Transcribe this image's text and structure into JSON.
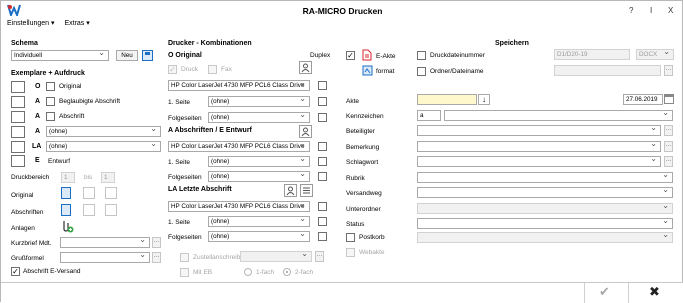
{
  "window": {
    "title": "RA-MICRO Drucken",
    "help": "?",
    "info": "I",
    "close": "X"
  },
  "menu": {
    "settings": "Einstellungen ▾",
    "extras": "Extras ▾"
  },
  "schema": {
    "header": "Schema",
    "value": "Individuell",
    "new_label": "Neu"
  },
  "copies": {
    "header": "Exemplare + Aufdruck",
    "rows": [
      {
        "letter": "O",
        "text": "Original"
      },
      {
        "letter": "A",
        "text": "Beglaubigte Abschrift"
      },
      {
        "letter": "A",
        "text": "Abschrift"
      },
      {
        "letter": "A",
        "text": "(ohne)"
      },
      {
        "letter": "LA",
        "text": "(ohne)"
      },
      {
        "letter": "E",
        "text": "Entwurf"
      }
    ]
  },
  "range": {
    "label": "Druckbereich",
    "from": "1",
    "to_label": "bis",
    "to": "1"
  },
  "layout": {
    "original": "Original",
    "copies": "Abschriften",
    "attachments": "Anlagen"
  },
  "short_letter": {
    "label": "Kurzbrief Mdt."
  },
  "greeting": {
    "label": "Grußformel"
  },
  "evshipping": {
    "label": "Abschrift E-Versand"
  },
  "printer": {
    "header": "Drucker - Kombinationen",
    "duplex": "Duplex",
    "original_title": "O  Original",
    "print_label": "Druck",
    "fax_label": "Fax",
    "printer_name": "HP Color LaserJet 4730 MFP PCL6 Class Drive",
    "first_page": "1. Seite",
    "following": "Folgeseiten",
    "none": "(ohne)",
    "copies_title": "A  Abschriften / E  Entwurf",
    "la_title": "LA Letzte Abschrift",
    "delivery": "Zustellanschreiben",
    "with_eb": "Mit EB",
    "one_fold": "1-fach",
    "two_fold": "2-fach"
  },
  "save": {
    "header": "Speichern",
    "eakte": "E-Akte",
    "format": "format",
    "print_file_number": "Druckdateinummer",
    "file_id": "D1/D20-19",
    "ext": "DOCX",
    "folder": "Ordner/Dateiname",
    "akte": "Akte",
    "date": "27.06.2019",
    "kennzeichen": "Kennzeichen",
    "kz_value": "a",
    "beteiligter": "Beteiligter",
    "bemerkung": "Bemerkung",
    "schlagwort": "Schlagwort",
    "rubrik": "Rubrik",
    "versandweg": "Versandweg",
    "unterordner": "Unterordner",
    "status": "Status",
    "postkorb": "Postkorb",
    "webakte": "Webakte"
  },
  "footer": {
    "ok": "✔",
    "cancel": "✖"
  },
  "colors": {
    "akte_bg": "#fff8cc",
    "accent": "#1a6fc4"
  }
}
